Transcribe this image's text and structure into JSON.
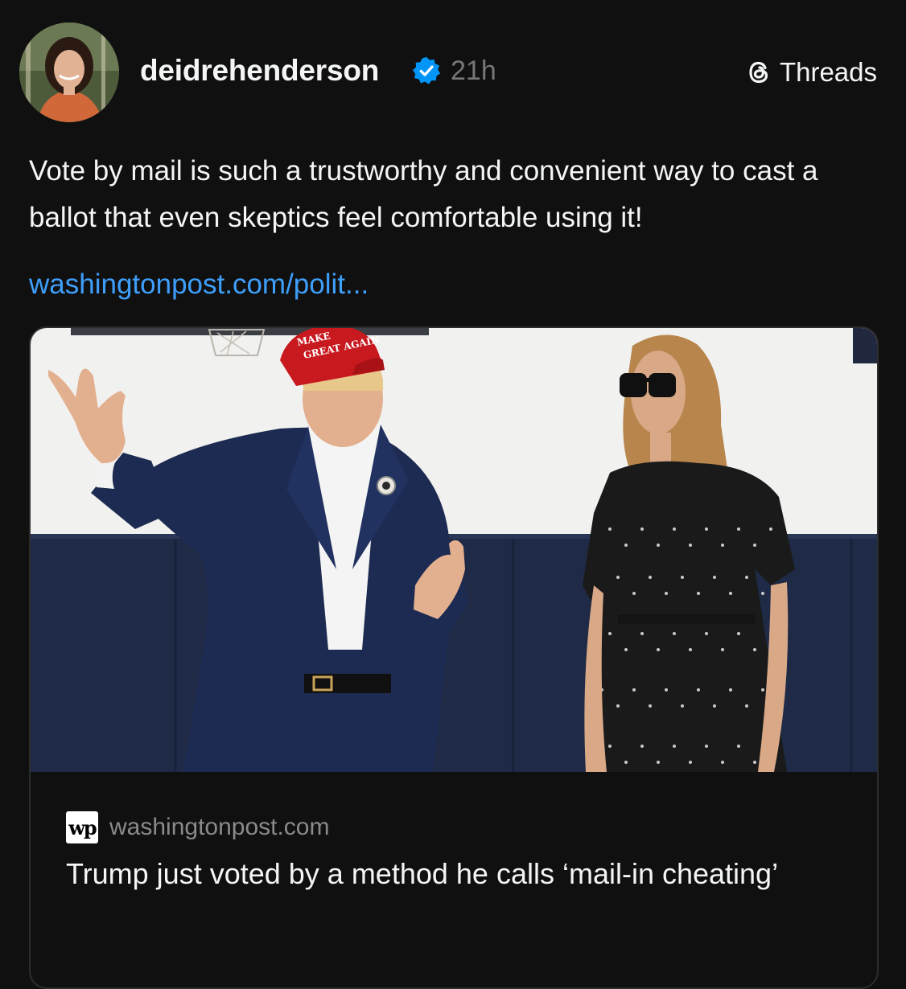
{
  "post": {
    "author": {
      "username": "deidrehenderson",
      "verified": true,
      "avatar_icon": "profile-photo"
    },
    "timestamp": "21h",
    "platform_label": "Threads",
    "text": "Vote by mail is such a trustworthy and convenient way to cast a ballot that even skeptics feel comfortable using it!",
    "link_text": "washingtonpost.com/polit..."
  },
  "link_card": {
    "domain": "washingtonpost.com",
    "publisher_logo_text": "wp",
    "title": "Trump just voted by a method he calls ‘mail-in cheating’",
    "image_hat_text_line1": "MAKE",
    "image_hat_text_line2": "GREAT AGAIN"
  },
  "colors": {
    "background": "#101010",
    "text_primary": "#f3f5f7",
    "text_secondary": "#777777",
    "link": "#3e9ffb",
    "verified_badge": "#0095f6",
    "card_border": "#2d2d2d",
    "hat_red": "#c8191f",
    "suit_navy": "#1d2b52"
  }
}
